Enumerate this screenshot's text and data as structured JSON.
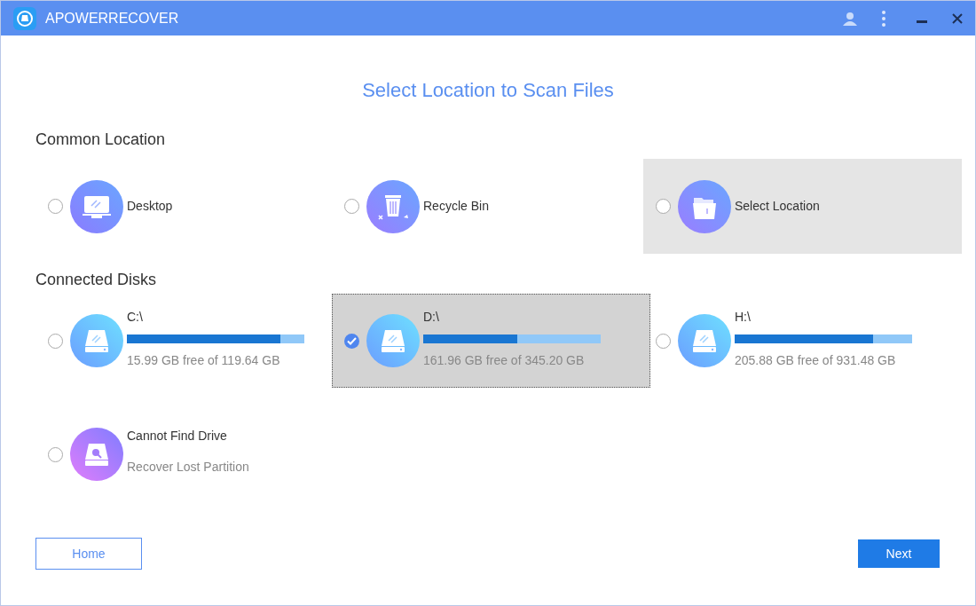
{
  "window": {
    "title": "APOWERRECOVER"
  },
  "heading": "Select Location to Scan Files",
  "common_location": {
    "title": "Common Location",
    "items": [
      {
        "kind": "desktop",
        "label": "Desktop",
        "selected": false,
        "highlighted": false
      },
      {
        "kind": "recycle",
        "label": "Recycle Bin",
        "selected": false,
        "highlighted": false
      },
      {
        "kind": "folder",
        "label": "Select Location",
        "selected": false,
        "highlighted": true
      }
    ]
  },
  "connected_disks": {
    "title": "Connected Disks",
    "items": [
      {
        "kind": "disk",
        "label": "C:\\",
        "level": 0.866,
        "reading": "15.99 GB free of 119.64 GB",
        "selected": false
      },
      {
        "kind": "disk",
        "label": "D:\\",
        "level": 0.531,
        "reading": "161.96 GB free of 345.20 GB",
        "selected": true
      },
      {
        "kind": "disk",
        "label": "H:\\",
        "level": 0.779,
        "reading": "205.88 GB free of 931.48 GB",
        "selected": false
      },
      {
        "kind": "partition",
        "label": "Cannot Find Drive",
        "reading": "Recover Lost Partition",
        "selected": false
      }
    ]
  },
  "buttons": {
    "home": "Home",
    "next": "Next"
  }
}
